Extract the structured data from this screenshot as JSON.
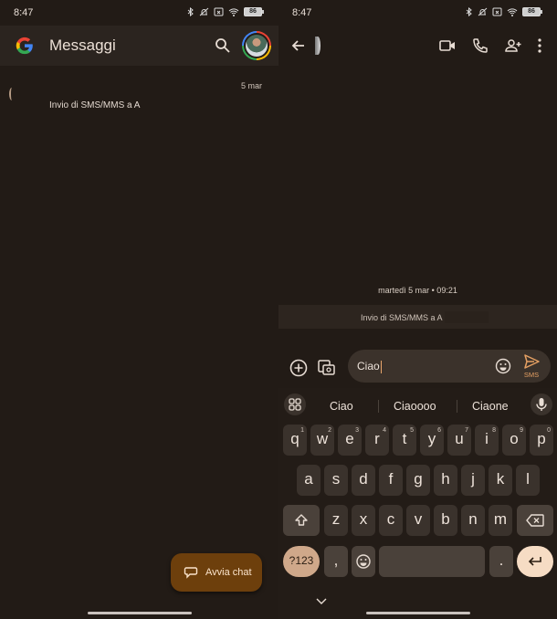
{
  "status_bar": {
    "time": "8:47",
    "battery": "86"
  },
  "left": {
    "app_title": "Messaggi",
    "conversations": [
      {
        "date": "5 mar",
        "name": "",
        "snippet": "Invio di SMS/MMS a A"
      }
    ],
    "fab_label": "Avvia chat"
  },
  "right": {
    "header_icons": [
      "video-call-icon",
      "phone-icon",
      "add-person-icon",
      "more-vert-icon"
    ],
    "date_separator": "martedì 5 mar • 09:21",
    "system_message": "Invio di SMS/MMS a A",
    "compose": {
      "value": "Ciao",
      "send_label": "SMS"
    },
    "accent_color": "#e5a063",
    "keyboard": {
      "suggestions": [
        "Ciao",
        "Ciaoooo",
        "Ciaone"
      ],
      "row1": [
        "q",
        "w",
        "e",
        "r",
        "t",
        "y",
        "u",
        "i",
        "o",
        "p"
      ],
      "row1_hints": [
        "1",
        "2",
        "3",
        "4",
        "5",
        "6",
        "7",
        "8",
        "9",
        "0"
      ],
      "row2": [
        "a",
        "s",
        "d",
        "f",
        "g",
        "h",
        "j",
        "k",
        "l"
      ],
      "row3": [
        "z",
        "x",
        "c",
        "v",
        "b",
        "n",
        "m"
      ],
      "symbols_label": "?123",
      "comma": ",",
      "period": "."
    }
  }
}
